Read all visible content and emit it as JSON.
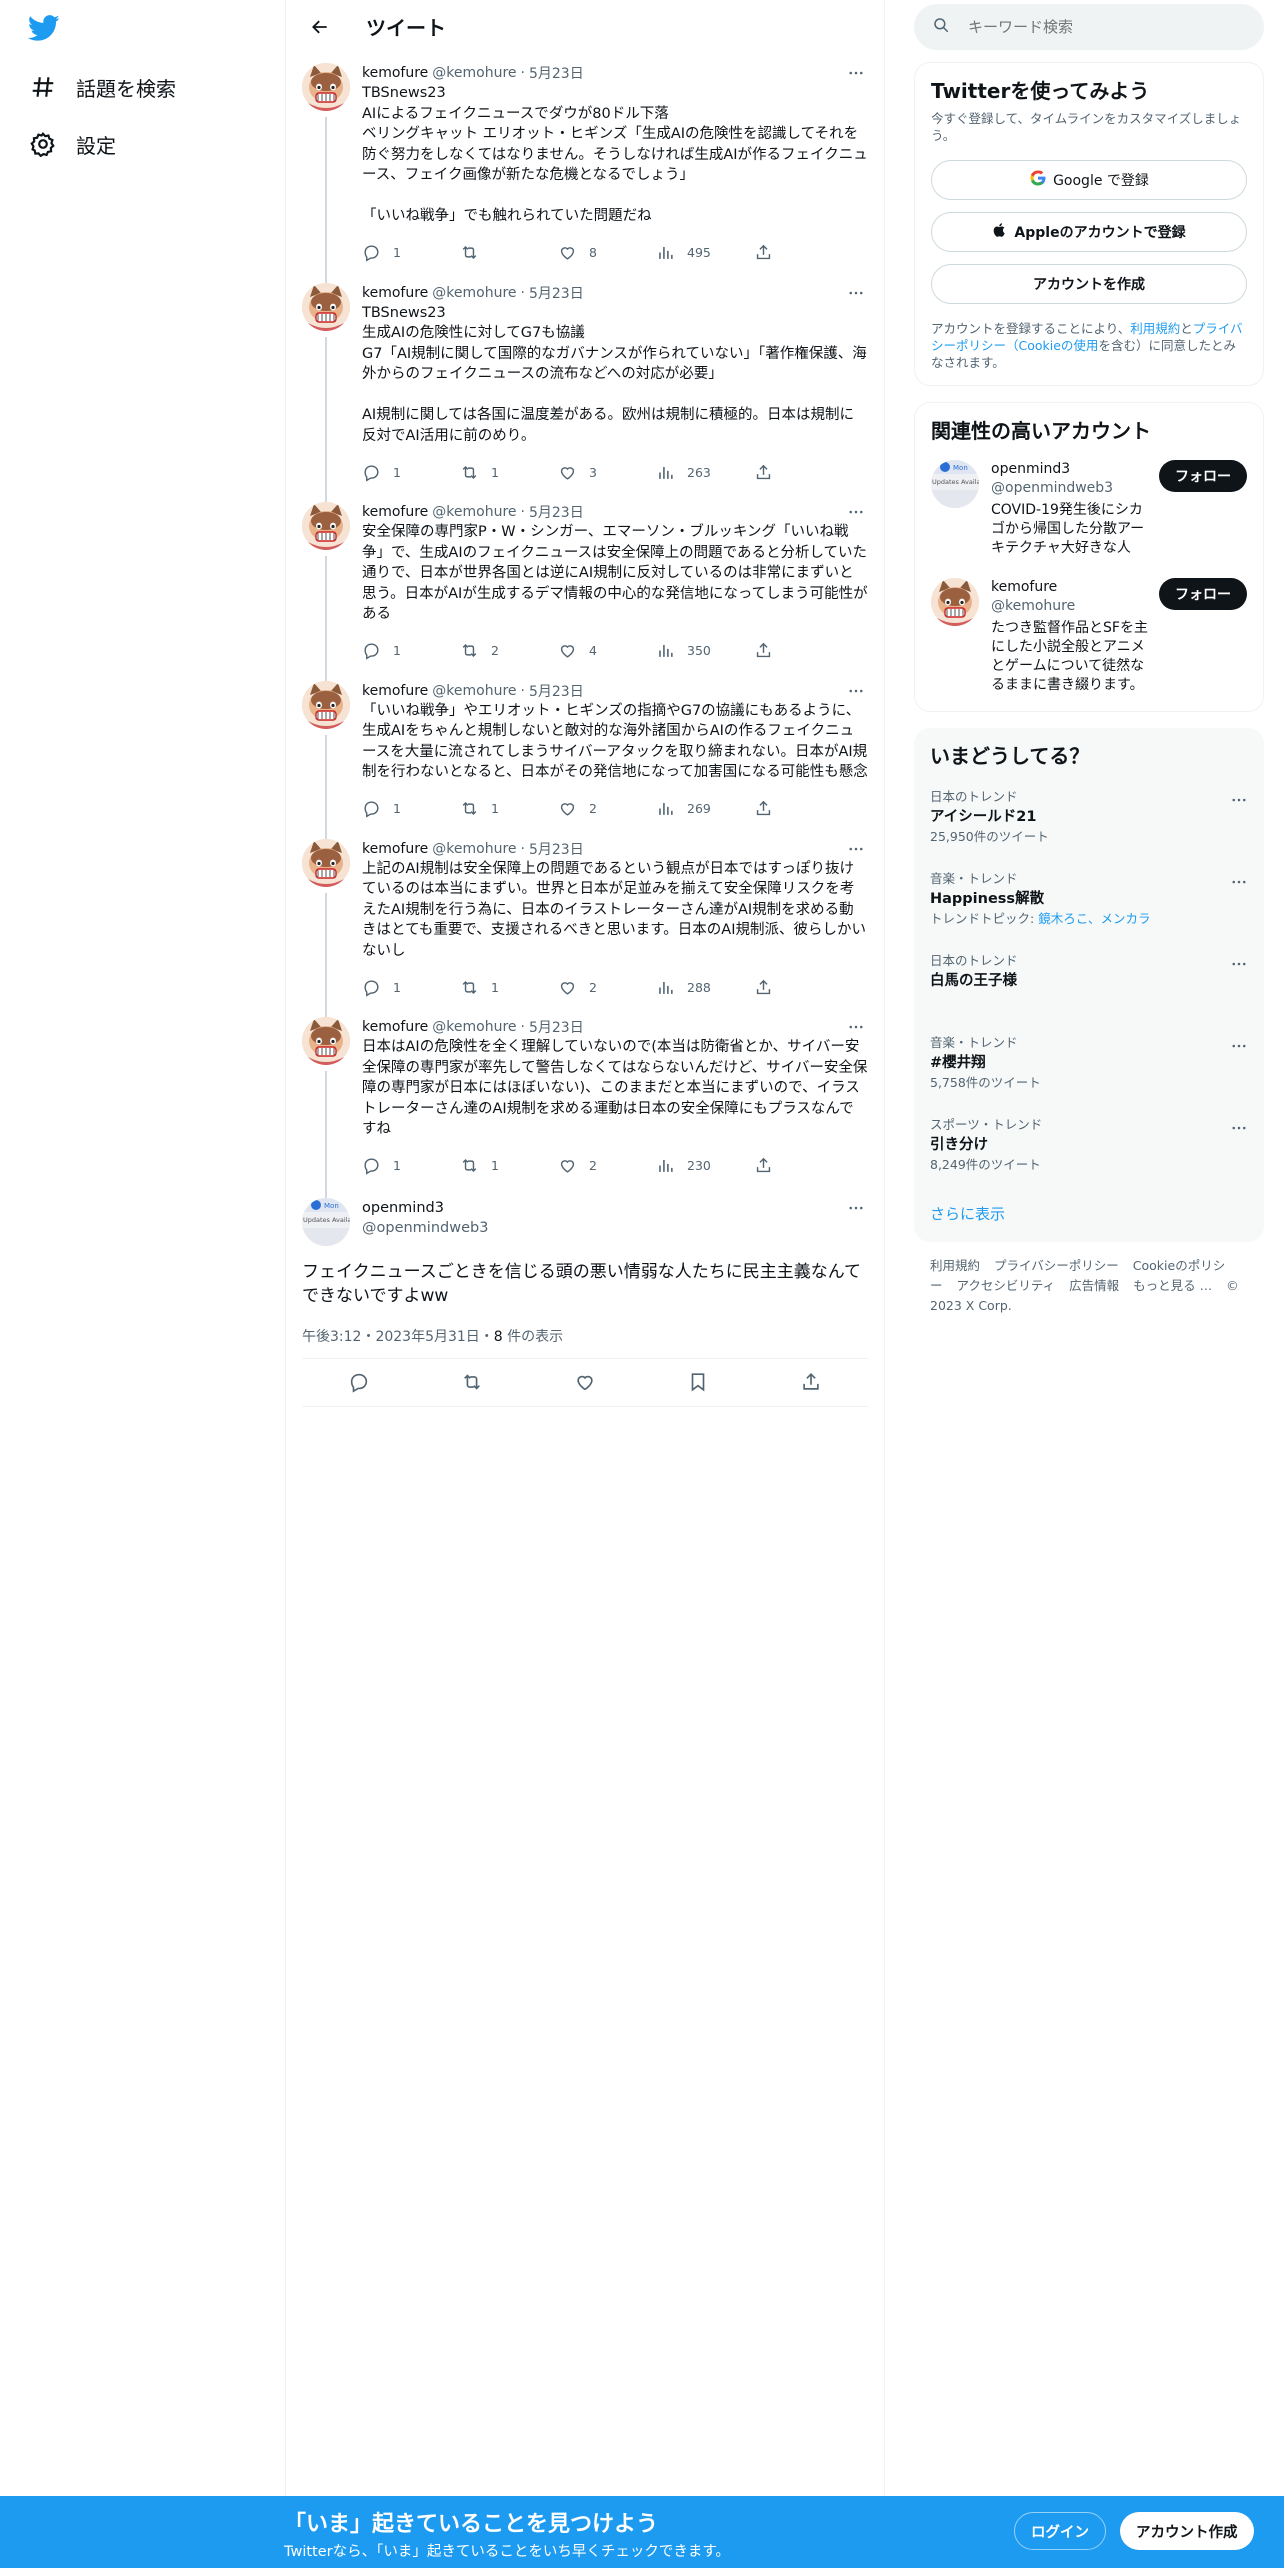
{
  "nav": {
    "explore_label": "話題を検索",
    "settings_label": "設定"
  },
  "header": {
    "title": "ツイート"
  },
  "thread": [
    {
      "name": "kemofure",
      "handle": "@kemohure",
      "date": "5月23日",
      "text": "TBSnews23\nAIによるフェイクニュースでダウが80ドル下落\nベリングキャット エリオット・ヒギンズ「生成AIの危険性を認識してそれを防ぐ努力をしなくてはなりません。そうしなければ生成AIが作るフェイクニュース、フェイク画像が新たな危機となるでしょう」\n\n「いいね戦争」でも触れられていた問題だね",
      "replies": "1",
      "retweets": "",
      "likes": "8",
      "views": "495"
    },
    {
      "name": "kemofure",
      "handle": "@kemohure",
      "date": "5月23日",
      "text": "TBSnews23\n生成AIの危険性に対してG7も協議\nG7「AI規制に関して国際的なガバナンスが作られていない」「著作権保護、海外からのフェイクニュースの流布などへの対応が必要」\n\nAI規制に関しては各国に温度差がある。欧州は規制に積極的。日本は規制に反対でAI活用に前のめり。",
      "replies": "1",
      "retweets": "1",
      "likes": "3",
      "views": "263"
    },
    {
      "name": "kemofure",
      "handle": "@kemohure",
      "date": "5月23日",
      "text": "安全保障の専門家P・W・シンガー、エマーソン・ブルッキング「いいね戦争」で、生成AIのフェイクニュースは安全保障上の問題であると分析していた通りで、日本が世界各国とは逆にAI規制に反対しているのは非常にまずいと思う。日本がAIが生成するデマ情報の中心的な発信地になってしまう可能性がある",
      "replies": "1",
      "retweets": "2",
      "likes": "4",
      "views": "350"
    },
    {
      "name": "kemofure",
      "handle": "@kemohure",
      "date": "5月23日",
      "text": "「いいね戦争」やエリオット・ヒギンズの指摘やG7の協議にもあるように、生成AIをちゃんと規制しないと敵対的な海外諸国からAIの作るフェイクニュースを大量に流されてしまうサイバーアタックを取り締まれない。日本がAI規制を行わないとなると、日本がその発信地になって加害国になる可能性も懸念",
      "replies": "1",
      "retweets": "1",
      "likes": "2",
      "views": "269"
    },
    {
      "name": "kemofure",
      "handle": "@kemohure",
      "date": "5月23日",
      "text": "上記のAI規制は安全保障上の問題であるという観点が日本ではすっぽり抜けているのは本当にまずい。世界と日本が足並みを揃えて安全保障リスクを考えたAI規制を行う為に、日本のイラストレーターさん達がAI規制を求める動きはとても重要で、支援されるべきと思います。日本のAI規制派、彼らしかいないし",
      "replies": "1",
      "retweets": "1",
      "likes": "2",
      "views": "288"
    },
    {
      "name": "kemofure",
      "handle": "@kemohure",
      "date": "5月23日",
      "text": "日本はAIの危険性を全く理解していないので(本当は防衛省とか、サイバー安全保障の専門家が率先して警告しなくてはならないんだけど、サイバー安全保障の専門家が日本にはほぼいない)、このままだと本当にまずいので、イラストレーターさん達のAI規制を求める運動は日本の安全保障にもプラスなんですね",
      "replies": "1",
      "retweets": "1",
      "likes": "2",
      "views": "230"
    }
  ],
  "focus": {
    "name": "openmind3",
    "handle": "@openmindweb3",
    "text": "フェイクニュースごときを信じる頭の悪い情弱な人たちに民主主義なんてできないですよww",
    "time": "午後3:12・2023年5月31日・",
    "views_count": "8",
    "views_label": " 件の表示"
  },
  "search": {
    "placeholder": "キーワード検索"
  },
  "signup": {
    "title": "Twitterを使ってみよう",
    "subtitle": "今すぐ登録して、タイムラインをカスタマイズしましょう。",
    "google": "Google で登録",
    "apple": "Appleのアカウントで登録",
    "create": "アカウントを作成",
    "legal_1": "アカウントを登録することにより、",
    "legal_link1": "利用規約",
    "legal_2": "と",
    "legal_link2": "プライバシーポリシー（Cookieの使用",
    "legal_3": "を含む）に同意したとみなされます。"
  },
  "who": {
    "title": "関連性の高いアカウント",
    "follow_label": "フォロー",
    "accounts": [
      {
        "name": "openmind3",
        "handle": "@openmindweb3",
        "bio": "COVID-19発生後にシカゴから帰国した分散アーキテクチャ大好きな人"
      },
      {
        "name": "kemofure",
        "handle": "@kemohure",
        "bio": "たつき監督作品とSFを主にした小説全般とアニメとゲームについて徒然なるままに書き綴ります。"
      }
    ],
    "avatar_badge": "Mon",
    "avatar_text": "Updates Available"
  },
  "trends": {
    "title": "いまどうしてる？",
    "items": [
      {
        "meta": "日本のトレンド",
        "name": "アイシールド21",
        "count": "25,950件のツイート"
      },
      {
        "meta": "音楽・トレンド",
        "name": "Happiness解散",
        "count_prefix": "トレンドトピック: ",
        "count_link": "鏡木ろこ、メンカラ"
      },
      {
        "meta": "日本のトレンド",
        "name": "白馬の王子様",
        "count": ""
      },
      {
        "meta": "音楽・トレンド",
        "name": "#櫻井翔",
        "count": "5,758件のツイート"
      },
      {
        "meta": "スポーツ・トレンド",
        "name": "引き分け",
        "count": "8,249件のツイート"
      }
    ],
    "show_more": "さらに表示"
  },
  "footer": {
    "links": [
      "利用規約",
      "プライバシーポリシー",
      "Cookieのポリシー",
      "アクセシビリティ",
      "広告情報",
      "もっと見る …",
      "© 2023 X Corp."
    ]
  },
  "banner": {
    "title": "「いま」起きていることを見つけよう",
    "subtitle": "Twitterなら、「いま」起きていることをいち早くチェックできます。",
    "login": "ログイン",
    "signup": "アカウント作成"
  },
  "colors": {
    "brand": "#1d9bf0",
    "text": "#0f1419",
    "muted": "#536471"
  }
}
